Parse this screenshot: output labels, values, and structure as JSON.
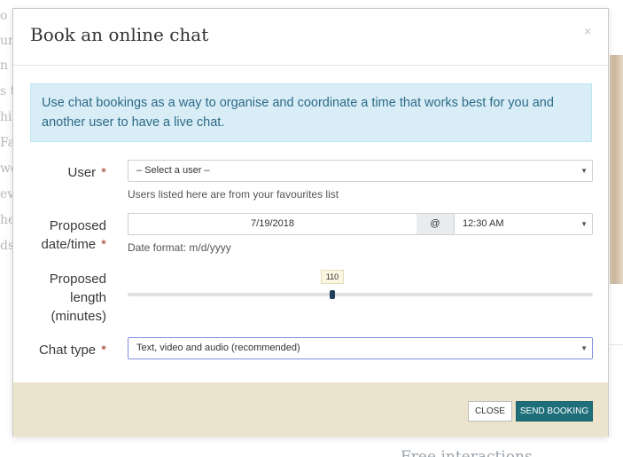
{
  "background": {
    "left_letters": [
      "o",
      "un",
      "n t",
      "s t",
      "hin",
      "Fa",
      "we",
      "ev",
      "he",
      "ds"
    ],
    "footer_text": "Free interactions"
  },
  "modal": {
    "title": "Book an online chat",
    "close_icon": "×",
    "info_text": "Use chat bookings as a way to organise and coordinate a time that works best for you and another user to have a live chat.",
    "required_marker": "*",
    "user": {
      "label": "User",
      "selected": "– Select a user –",
      "hint": "Users listed here are from your favourites list"
    },
    "datetime": {
      "label_line1": "Proposed",
      "label_line2": "date/time",
      "date_value": "7/19/2018",
      "at_symbol": "@",
      "time_selected": "12:30 AM",
      "hint": "Date format: m/d/yyyy"
    },
    "length": {
      "label_line1": "Proposed",
      "label_line2": "length",
      "label_line3": "(minutes)",
      "value": "110",
      "fraction": 0.44
    },
    "chat_type": {
      "label": "Chat type",
      "selected": "Text, video and audio (recommended)"
    },
    "footer": {
      "close_label": "CLOSE",
      "send_label": "SEND BOOKING"
    },
    "colors": {
      "info_bg": "#d9edf7",
      "info_text": "#2c6a86",
      "footer_bg": "#ebe3cc",
      "send_button": "#1f6f7a",
      "required": "#a33a2e",
      "focus_border": "#7f8fe0"
    }
  }
}
